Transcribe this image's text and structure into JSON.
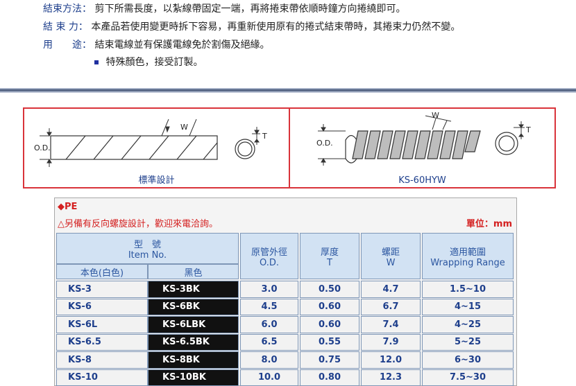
{
  "specs": [
    {
      "label": "結束方法：",
      "text": "剪下所需長度，以紮線帶固定一端，再將捲束帶依順時鐘方向捲繞即可。"
    },
    {
      "label": "結 束 力：",
      "text": "本產品若使用變更時拆下容易，再重新使用原有的捲式結束帶時，其捲束力仍然不變。"
    },
    {
      "label": "用　　途：",
      "text": "結束電線並有保護電線免於割傷及絕緣。"
    }
  ],
  "bullet_note": "特殊顏色，接受訂製。",
  "diagrams": {
    "left": {
      "caption": "標準設計",
      "w_label": "W",
      "od_label": "O.D.",
      "t_label": "T"
    },
    "right": {
      "caption": "KS-60HYW",
      "w_label": "W",
      "od_label": "O.D.",
      "t_label": "T"
    }
  },
  "table": {
    "material": "◆PE",
    "note": "△另備有反向螺旋設計，歡迎來電洽詢。",
    "unit": "單位：mm",
    "headers": {
      "model": "型　號",
      "model_en": "Item No.",
      "white": "本色(白色)",
      "black": "黑色",
      "od": "原管外徑",
      "od_en": "O.D.",
      "thickness": "厚度",
      "thickness_en": "T",
      "pitch": "螺距",
      "pitch_en": "W",
      "range": "適用範圍",
      "range_en": "Wrapping Range"
    },
    "rows": [
      {
        "white": "KS-3",
        "black": "KS-3BK",
        "od": "3.0",
        "t": "0.50",
        "w": "4.7",
        "range": "1.5~10"
      },
      {
        "white": "KS-6",
        "black": "KS-6BK",
        "od": "4.5",
        "t": "0.60",
        "w": "6.7",
        "range": "4~15"
      },
      {
        "white": "KS-6L",
        "black": "KS-6LBK",
        "od": "6.0",
        "t": "0.60",
        "w": "7.4",
        "range": "4~25"
      },
      {
        "white": "KS-6.5",
        "black": "KS-6.5BK",
        "od": "6.5",
        "t": "0.55",
        "w": "7.9",
        "range": "5~25"
      },
      {
        "white": "KS-8",
        "black": "KS-8BK",
        "od": "8.0",
        "t": "0.75",
        "w": "12.0",
        "range": "6~30"
      },
      {
        "white": "KS-10",
        "black": "KS-10BK",
        "od": "10.0",
        "t": "0.80",
        "w": "12.3",
        "range": "7.5~30"
      }
    ]
  }
}
